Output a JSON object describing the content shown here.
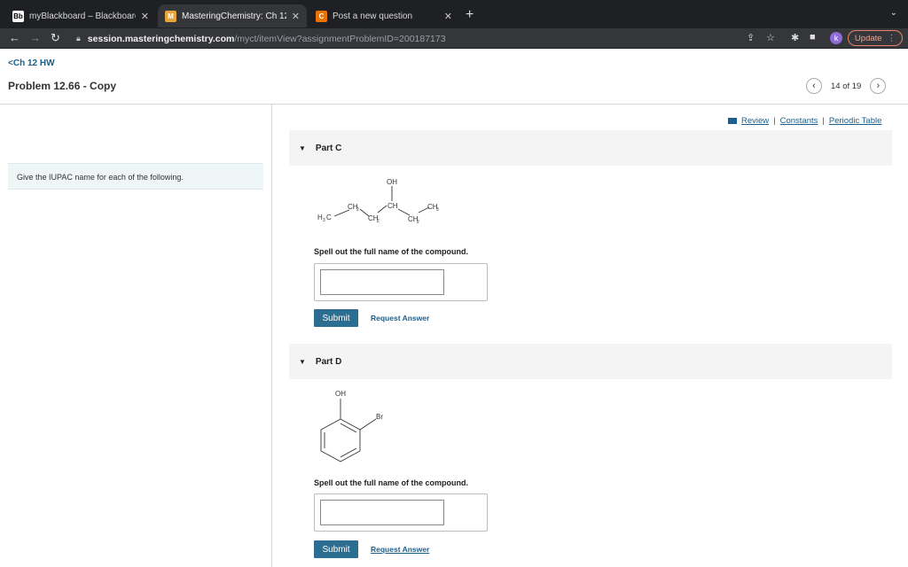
{
  "browser": {
    "tabs": [
      {
        "title": "myBlackboard – Blackboard Le",
        "icon": "blackboard-favicon",
        "active": false
      },
      {
        "title": "MasteringChemistry: Ch 12 HW",
        "icon": "mastering-favicon",
        "active": true
      },
      {
        "title": "Post a new question",
        "icon": "chegg-favicon",
        "active": false
      }
    ],
    "url_host": "session.masteringchemistry.com",
    "url_path": "/myct/itemView?assignmentProblemID=200187173",
    "profile_initial": "k",
    "update_label": "Update"
  },
  "header": {
    "back_label": "Ch 12 HW",
    "problem_title": "Problem 12.66 - Copy",
    "pager_text": "14 of 19"
  },
  "instruction": "Give the IUPAC name for each of the following.",
  "resources": {
    "review": "Review",
    "constants": "Constants",
    "periodic_table": "Periodic Table"
  },
  "parts": [
    {
      "label": "Part C",
      "structure_labels": {
        "oh": "OH",
        "ch": "CH",
        "ch2a": "CH",
        "ch2b": "CH",
        "ch2c": "CH",
        "ch3": "CH",
        "h3c": "H",
        "c": "C"
      },
      "prompt": "Spell out the full name of the compound.",
      "answer_value": "",
      "submit_label": "Submit",
      "request_label": "Request Answer"
    },
    {
      "label": "Part D",
      "structure_labels": {
        "oh": "OH",
        "br": "Br"
      },
      "prompt": "Spell out the full name of the compound.",
      "answer_value": "",
      "submit_label": "Submit",
      "request_label": "Request Answer"
    }
  ],
  "colors": {
    "link": "#1c5f8c",
    "submit": "#2c6e91",
    "panel": "#eef6f7"
  }
}
